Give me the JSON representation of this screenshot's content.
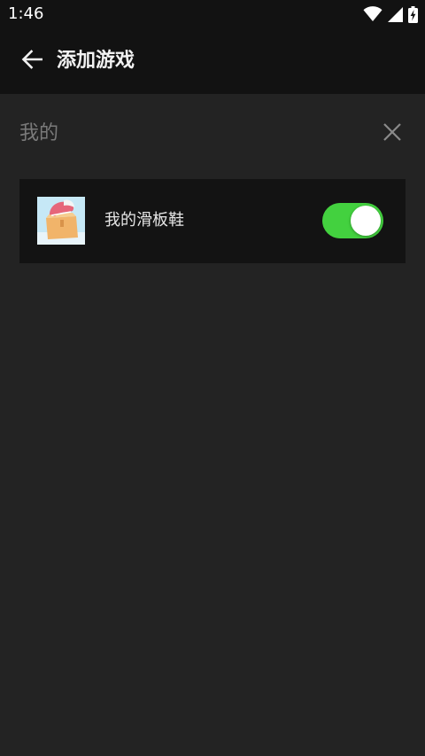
{
  "status_bar": {
    "time": "1:46",
    "icons": [
      "wifi-icon",
      "signal-icon",
      "battery-charging-icon"
    ]
  },
  "app_bar": {
    "back_icon": "arrow-left-icon",
    "title": "添加游戏"
  },
  "section": {
    "title": "我的",
    "close_icon": "close-icon"
  },
  "games": [
    {
      "name": "我的滑板鞋",
      "thumbnail_icon": "game-thumbnail",
      "enabled": true
    }
  ],
  "colors": {
    "background": "#232323",
    "app_bar": "#121212",
    "card": "#131313",
    "toggle_on": "#43d13f",
    "section_title": "#7a7a7a"
  }
}
